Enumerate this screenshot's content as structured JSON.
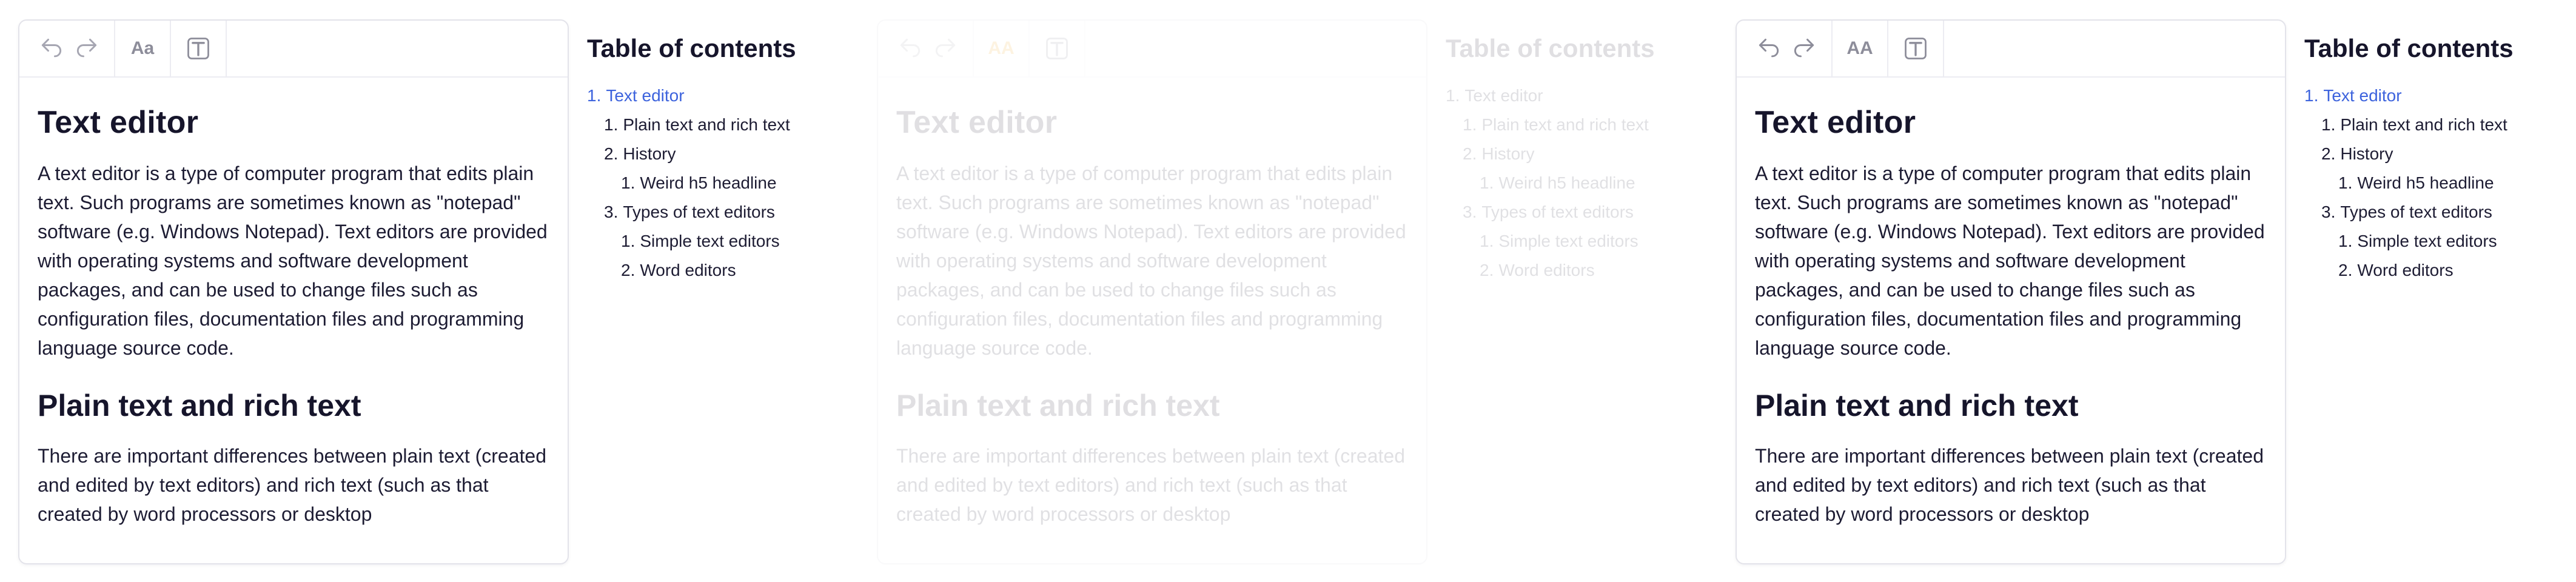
{
  "toolbar": {
    "undo_icon": "undo-icon",
    "redo_icon": "redo-icon",
    "font_size_glyph": "Aa",
    "font_size_glyph_large": "AA",
    "text_style_glyph": "T"
  },
  "document": {
    "title": "Text editor",
    "intro": "A text editor is a type of computer program that edits plain text. Such programs are sometimes known as \"notepad\" software (e.g. Windows Notepad). Text editors are provided with operating systems and software development packages, and can be used to change files such as configuration files, documentation files and programming language source code.",
    "h2": "Plain text and rich text",
    "body": "There are important differences between plain text (created and edited by text editors) and rich text (such as that created by word processors or desktop"
  },
  "toc": {
    "title": "Table of contents",
    "items": [
      {
        "num": "1.",
        "label": "Text editor"
      },
      {
        "num": "1.",
        "label": "Plain text and rich text"
      },
      {
        "num": "2.",
        "label": "History"
      },
      {
        "num": "1.",
        "label": "Weird h5 headline"
      },
      {
        "num": "3.",
        "label": "Types of text editors"
      },
      {
        "num": "1.",
        "label": "Simple text editors"
      },
      {
        "num": "2.",
        "label": "Word editors"
      }
    ]
  },
  "colors": {
    "accent": "#3d63dd",
    "text": "#16152b",
    "icon": "#8d8d9a",
    "highlight": "#f5a623"
  }
}
